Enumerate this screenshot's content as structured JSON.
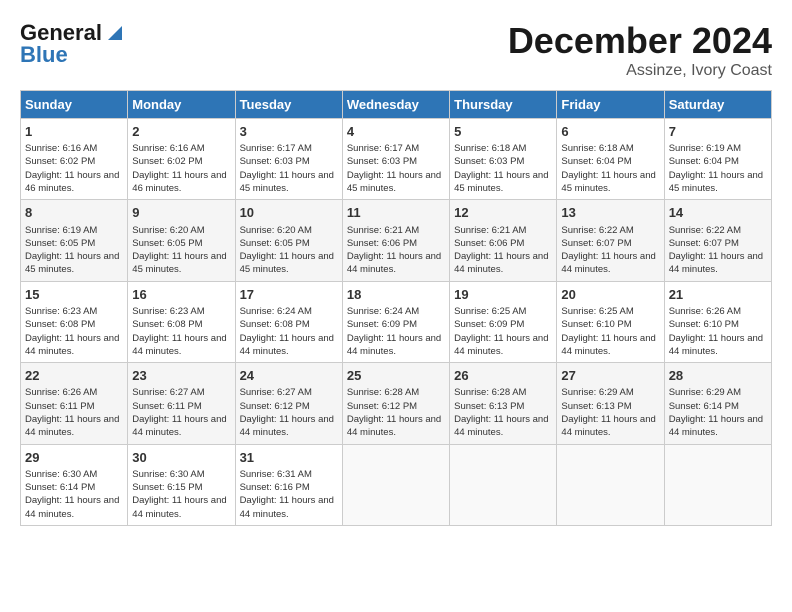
{
  "logo": {
    "line1": "General",
    "line2": "Blue"
  },
  "title": "December 2024",
  "subtitle": "Assinze, Ivory Coast",
  "days_of_week": [
    "Sunday",
    "Monday",
    "Tuesday",
    "Wednesday",
    "Thursday",
    "Friday",
    "Saturday"
  ],
  "weeks": [
    [
      {
        "day": 1,
        "sunrise": "6:16 AM",
        "sunset": "6:02 PM",
        "daylight": "11 hours and 46 minutes."
      },
      {
        "day": 2,
        "sunrise": "6:16 AM",
        "sunset": "6:02 PM",
        "daylight": "11 hours and 46 minutes."
      },
      {
        "day": 3,
        "sunrise": "6:17 AM",
        "sunset": "6:03 PM",
        "daylight": "11 hours and 45 minutes."
      },
      {
        "day": 4,
        "sunrise": "6:17 AM",
        "sunset": "6:03 PM",
        "daylight": "11 hours and 45 minutes."
      },
      {
        "day": 5,
        "sunrise": "6:18 AM",
        "sunset": "6:03 PM",
        "daylight": "11 hours and 45 minutes."
      },
      {
        "day": 6,
        "sunrise": "6:18 AM",
        "sunset": "6:04 PM",
        "daylight": "11 hours and 45 minutes."
      },
      {
        "day": 7,
        "sunrise": "6:19 AM",
        "sunset": "6:04 PM",
        "daylight": "11 hours and 45 minutes."
      }
    ],
    [
      {
        "day": 8,
        "sunrise": "6:19 AM",
        "sunset": "6:05 PM",
        "daylight": "11 hours and 45 minutes."
      },
      {
        "day": 9,
        "sunrise": "6:20 AM",
        "sunset": "6:05 PM",
        "daylight": "11 hours and 45 minutes."
      },
      {
        "day": 10,
        "sunrise": "6:20 AM",
        "sunset": "6:05 PM",
        "daylight": "11 hours and 45 minutes."
      },
      {
        "day": 11,
        "sunrise": "6:21 AM",
        "sunset": "6:06 PM",
        "daylight": "11 hours and 44 minutes."
      },
      {
        "day": 12,
        "sunrise": "6:21 AM",
        "sunset": "6:06 PM",
        "daylight": "11 hours and 44 minutes."
      },
      {
        "day": 13,
        "sunrise": "6:22 AM",
        "sunset": "6:07 PM",
        "daylight": "11 hours and 44 minutes."
      },
      {
        "day": 14,
        "sunrise": "6:22 AM",
        "sunset": "6:07 PM",
        "daylight": "11 hours and 44 minutes."
      }
    ],
    [
      {
        "day": 15,
        "sunrise": "6:23 AM",
        "sunset": "6:08 PM",
        "daylight": "11 hours and 44 minutes."
      },
      {
        "day": 16,
        "sunrise": "6:23 AM",
        "sunset": "6:08 PM",
        "daylight": "11 hours and 44 minutes."
      },
      {
        "day": 17,
        "sunrise": "6:24 AM",
        "sunset": "6:08 PM",
        "daylight": "11 hours and 44 minutes."
      },
      {
        "day": 18,
        "sunrise": "6:24 AM",
        "sunset": "6:09 PM",
        "daylight": "11 hours and 44 minutes."
      },
      {
        "day": 19,
        "sunrise": "6:25 AM",
        "sunset": "6:09 PM",
        "daylight": "11 hours and 44 minutes."
      },
      {
        "day": 20,
        "sunrise": "6:25 AM",
        "sunset": "6:10 PM",
        "daylight": "11 hours and 44 minutes."
      },
      {
        "day": 21,
        "sunrise": "6:26 AM",
        "sunset": "6:10 PM",
        "daylight": "11 hours and 44 minutes."
      }
    ],
    [
      {
        "day": 22,
        "sunrise": "6:26 AM",
        "sunset": "6:11 PM",
        "daylight": "11 hours and 44 minutes."
      },
      {
        "day": 23,
        "sunrise": "6:27 AM",
        "sunset": "6:11 PM",
        "daylight": "11 hours and 44 minutes."
      },
      {
        "day": 24,
        "sunrise": "6:27 AM",
        "sunset": "6:12 PM",
        "daylight": "11 hours and 44 minutes."
      },
      {
        "day": 25,
        "sunrise": "6:28 AM",
        "sunset": "6:12 PM",
        "daylight": "11 hours and 44 minutes."
      },
      {
        "day": 26,
        "sunrise": "6:28 AM",
        "sunset": "6:13 PM",
        "daylight": "11 hours and 44 minutes."
      },
      {
        "day": 27,
        "sunrise": "6:29 AM",
        "sunset": "6:13 PM",
        "daylight": "11 hours and 44 minutes."
      },
      {
        "day": 28,
        "sunrise": "6:29 AM",
        "sunset": "6:14 PM",
        "daylight": "11 hours and 44 minutes."
      }
    ],
    [
      {
        "day": 29,
        "sunrise": "6:30 AM",
        "sunset": "6:14 PM",
        "daylight": "11 hours and 44 minutes."
      },
      {
        "day": 30,
        "sunrise": "6:30 AM",
        "sunset": "6:15 PM",
        "daylight": "11 hours and 44 minutes."
      },
      {
        "day": 31,
        "sunrise": "6:31 AM",
        "sunset": "6:16 PM",
        "daylight": "11 hours and 44 minutes."
      },
      null,
      null,
      null,
      null
    ]
  ]
}
